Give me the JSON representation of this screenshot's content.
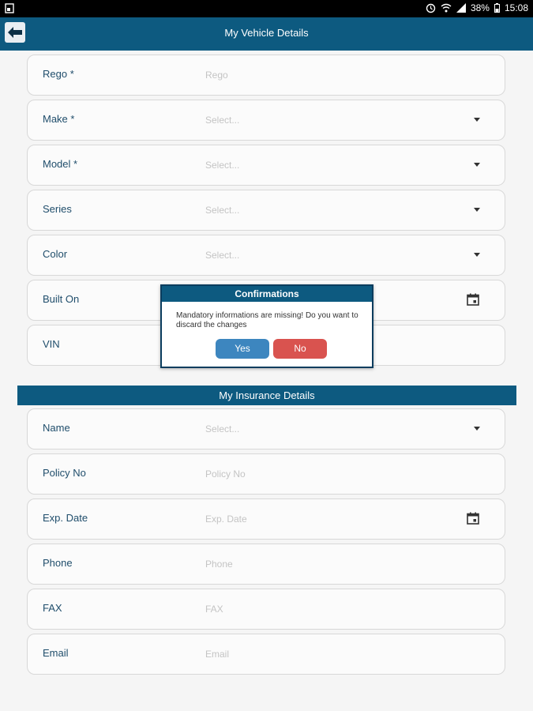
{
  "status_bar": {
    "battery": "38%",
    "time": "15:08"
  },
  "header": {
    "title": "My Vehicle Details",
    "back_icon": "arrow-left-icon"
  },
  "vehicle_fields": [
    {
      "label": "Rego *",
      "value": "Rego",
      "kind": "text"
    },
    {
      "label": "Make *",
      "value": "Select...",
      "kind": "dropdown"
    },
    {
      "label": "Model *",
      "value": "Select...",
      "kind": "dropdown"
    },
    {
      "label": "Series",
      "value": "Select...",
      "kind": "dropdown"
    },
    {
      "label": "Color",
      "value": "Select...",
      "kind": "dropdown"
    },
    {
      "label": "Built On",
      "value": "",
      "kind": "date"
    },
    {
      "label": "VIN",
      "value": "",
      "kind": "text"
    }
  ],
  "insurance_section": {
    "title": "My Insurance Details"
  },
  "insurance_fields": [
    {
      "label": "Name",
      "value": "Select...",
      "kind": "dropdown"
    },
    {
      "label": "Policy No",
      "value": "Policy No",
      "kind": "text"
    },
    {
      "label": "Exp. Date",
      "value": "Exp. Date",
      "kind": "date"
    },
    {
      "label": "Phone",
      "value": "Phone",
      "kind": "text"
    },
    {
      "label": "FAX",
      "value": "FAX",
      "kind": "text"
    },
    {
      "label": "Email",
      "value": "Email",
      "kind": "text"
    }
  ],
  "dialog": {
    "title": "Confirmations",
    "message": "Mandatory informations are missing! Do you want to discard the changes",
    "yes_label": "Yes",
    "no_label": "No"
  },
  "colors": {
    "primary": "#0d5a80",
    "yes_button": "#3d86bf",
    "no_button": "#d9534f",
    "label_text": "#1f4d6b",
    "placeholder_text": "#c4c4c4"
  }
}
